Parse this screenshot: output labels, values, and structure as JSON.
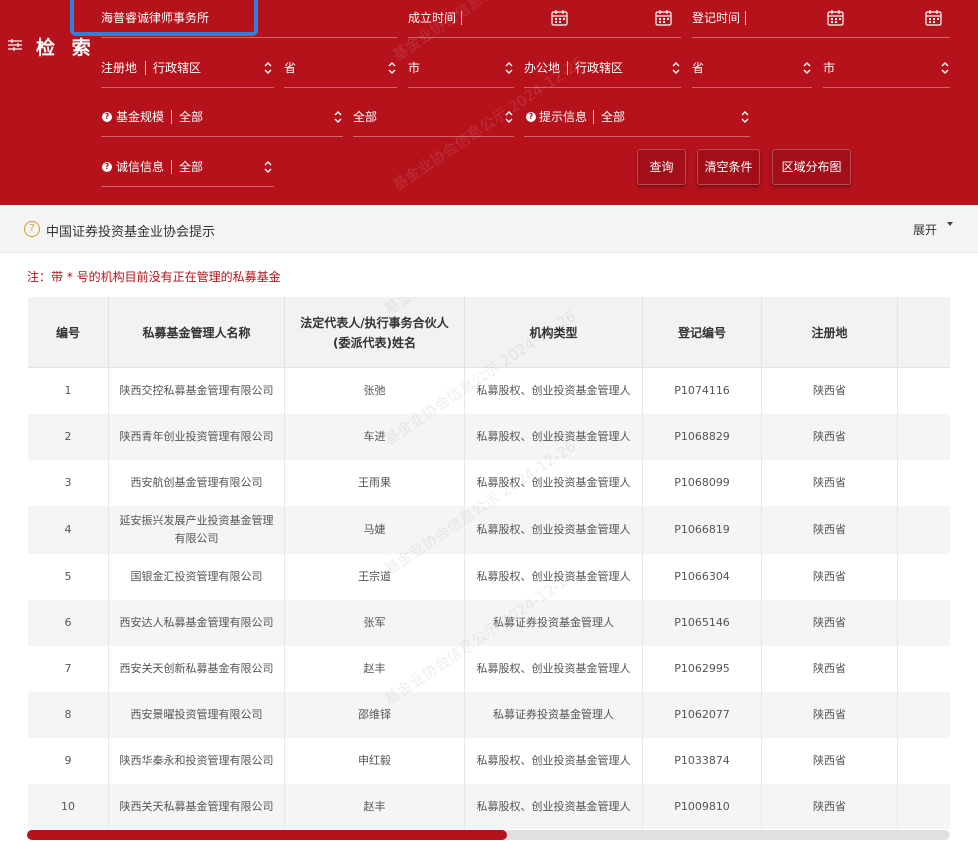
{
  "search": {
    "title": "检 索",
    "keyword": "海普睿诚律师事务所",
    "established_label": "成立时间",
    "registered_label": "登记时间",
    "reg_place_label": "注册地",
    "office_label": "办公地",
    "district_label": "行政辖区",
    "province_label": "省",
    "city_label": "市",
    "fund_size_label": "基金规模",
    "prompt_label": "提示信息",
    "credit_label": "诚信信息",
    "all_option": "全部",
    "query_button": "查询",
    "clear_button": "清空条件",
    "distribution_button": "区域分布图"
  },
  "notice": {
    "text": "中国证券投资基金业协会提示",
    "expand_label": "展开",
    "footnote": "注：带 * 号的机构目前没有正在管理的私募基金"
  },
  "watermark": "基金业协会信息公示 2024-12-26",
  "table": {
    "headers": {
      "index": "编号",
      "name": "私募基金管理人名称",
      "rep_line1": "法定代表人/执行事务合伙人",
      "rep_line2": "(委派代表)姓名",
      "type": "机构类型",
      "reg_no": "登记编号",
      "reg_place": "注册地"
    },
    "rows": [
      {
        "index": "1",
        "name": "陕西交控私募基金管理有限公司",
        "rep": "张弛",
        "type": "私募股权、创业投资基金管理人",
        "reg_no": "P1074116",
        "reg_place": "陕西省"
      },
      {
        "index": "2",
        "name": "陕西青年创业投资管理有限公司",
        "rep": "车进",
        "type": "私募股权、创业投资基金管理人",
        "reg_no": "P1068829",
        "reg_place": "陕西省"
      },
      {
        "index": "3",
        "name": "西安航创基金管理有限公司",
        "rep": "王雨果",
        "type": "私募股权、创业投资基金管理人",
        "reg_no": "P1068099",
        "reg_place": "陕西省"
      },
      {
        "index": "4",
        "name": "延安振兴发展产业投资基金管理有限公司",
        "rep": "马婕",
        "type": "私募股权、创业投资基金管理人",
        "reg_no": "P1066819",
        "reg_place": "陕西省"
      },
      {
        "index": "5",
        "name": "国银金汇投资管理有限公司",
        "rep": "王宗道",
        "type": "私募股权、创业投资基金管理人",
        "reg_no": "P1066304",
        "reg_place": "陕西省"
      },
      {
        "index": "6",
        "name": "西安达人私募基金管理有限公司",
        "rep": "张军",
        "type": "私募证券投资基金管理人",
        "reg_no": "P1065146",
        "reg_place": "陕西省"
      },
      {
        "index": "7",
        "name": "西安关天创新私募基金有限公司",
        "rep": "赵丰",
        "type": "私募股权、创业投资基金管理人",
        "reg_no": "P1062995",
        "reg_place": "陕西省"
      },
      {
        "index": "8",
        "name": "西安景曜投资管理有限公司",
        "rep": "邵维铎",
        "type": "私募证券投资基金管理人",
        "reg_no": "P1062077",
        "reg_place": "陕西省"
      },
      {
        "index": "9",
        "name": "陕西华秦永和投资管理有限公司",
        "rep": "申红毅",
        "type": "私募股权、创业投资基金管理人",
        "reg_no": "P1033874",
        "reg_place": "陕西省"
      },
      {
        "index": "10",
        "name": "陕西关天私募基金管理有限公司",
        "rep": "赵丰",
        "type": "私募股权、创业投资基金管理人",
        "reg_no": "P1009810",
        "reg_place": "陕西省"
      }
    ]
  },
  "colors": {
    "brand_red": "#b5121b",
    "highlight_blue": "#2f7fe0"
  }
}
